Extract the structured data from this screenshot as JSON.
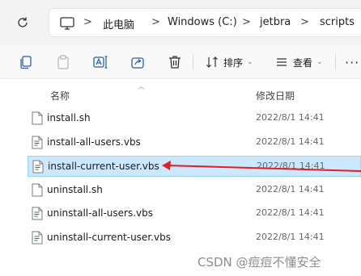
{
  "address_bar": {
    "breadcrumb": [
      "此电脑",
      "Windows (C:)",
      "jetbra",
      "scripts"
    ],
    "separator": ">"
  },
  "toolbar": {
    "buttons": [
      {
        "icon": "copy-icon"
      },
      {
        "icon": "paste-icon"
      },
      {
        "icon": "rename-icon"
      },
      {
        "icon": "share-icon"
      },
      {
        "icon": "delete-icon"
      }
    ],
    "sort_label": "排序",
    "view_label": "查看",
    "more_label": "···"
  },
  "columns": {
    "name": "名称",
    "modified": "修改日期"
  },
  "files": [
    {
      "name": "install.sh",
      "modified": "2022/8/1 14:41",
      "type": "file",
      "selected": false
    },
    {
      "name": "install-all-users.vbs",
      "modified": "2022/8/1 14:41",
      "type": "script",
      "selected": false
    },
    {
      "name": "install-current-user.vbs",
      "modified": "2022/8/1 14:41",
      "type": "script",
      "selected": true
    },
    {
      "name": "uninstall.sh",
      "modified": "2022/8/1 14:41",
      "type": "file",
      "selected": false
    },
    {
      "name": "uninstall-all-users.vbs",
      "modified": "2022/8/1 14:41",
      "type": "script",
      "selected": false
    },
    {
      "name": "uninstall-current-user.vbs",
      "modified": "2022/8/1 14:41",
      "type": "script",
      "selected": false
    }
  ],
  "annotation": {
    "arrow_color": "#e02020"
  },
  "watermark": "CSDN @痘痘不懂安全",
  "colors": {
    "selection_bg": "#cce8ff",
    "selection_border": "#99d1ff"
  }
}
